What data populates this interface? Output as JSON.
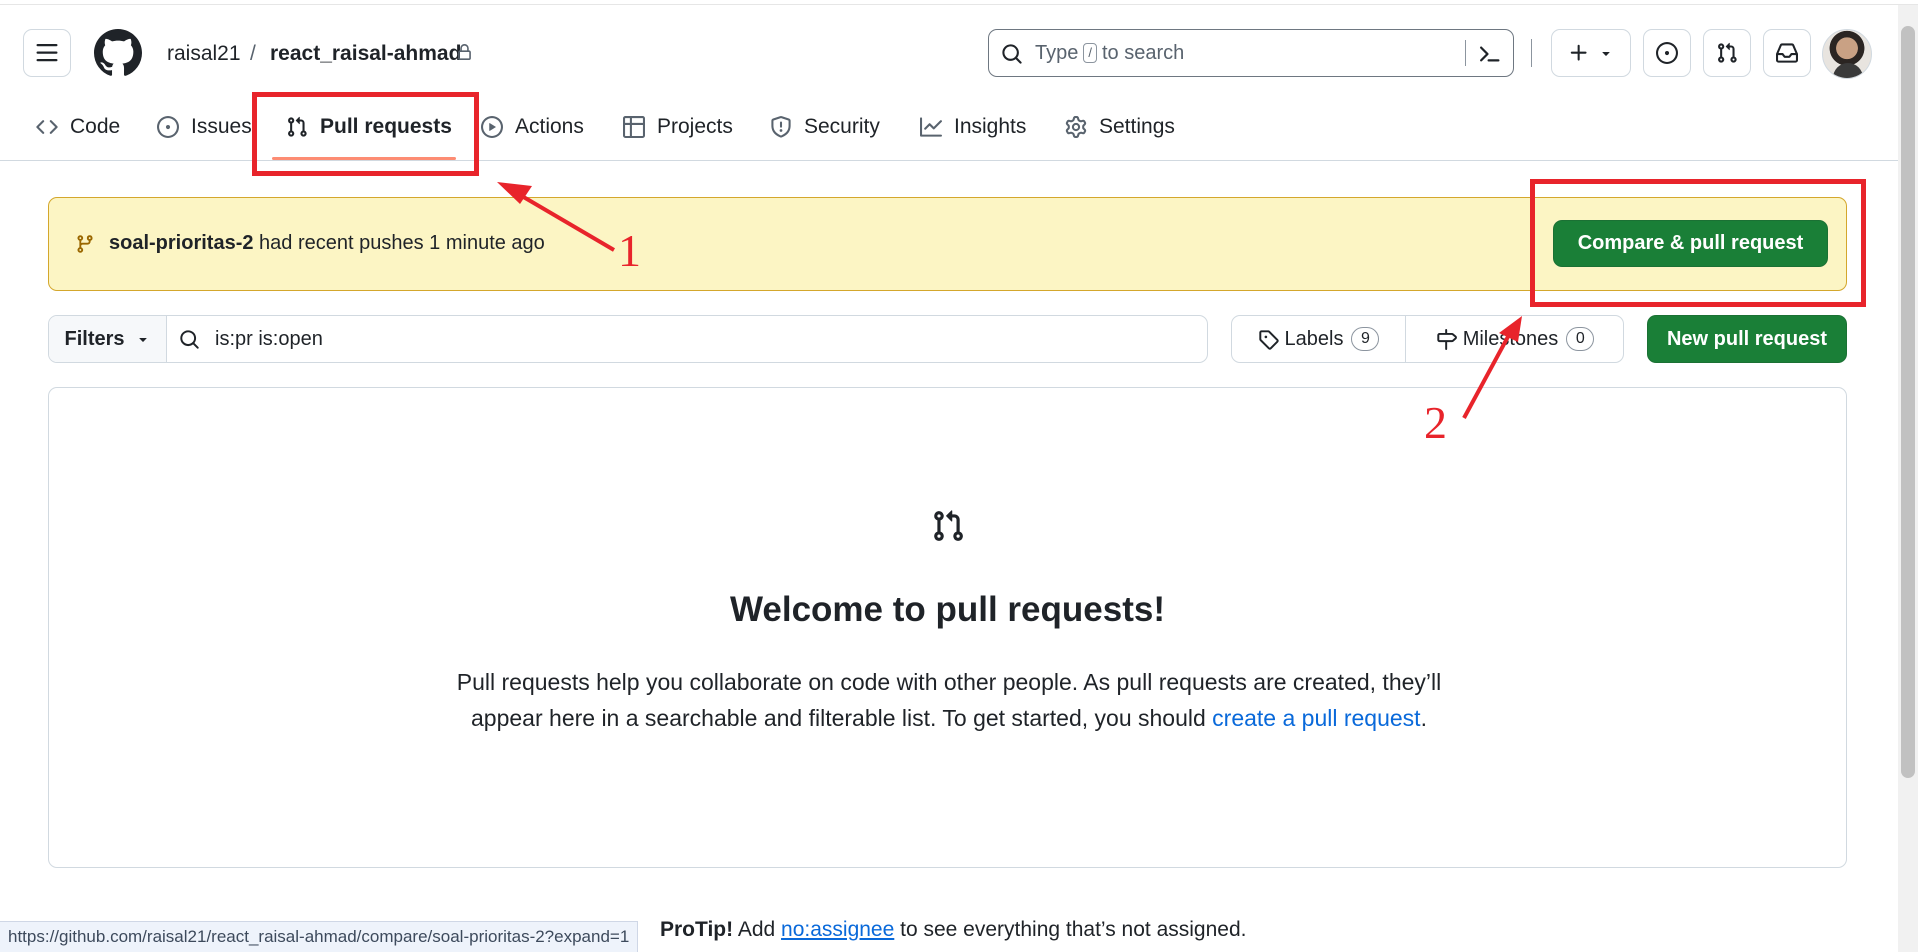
{
  "header": {
    "owner": "raisal21",
    "separator": "/",
    "repo": "react_raisal-ahmad",
    "search_prefix": "Type",
    "search_key": "/",
    "search_suffix": "to search"
  },
  "tabs": [
    {
      "label": "Code",
      "icon": "code-icon"
    },
    {
      "label": "Issues",
      "icon": "issue-opened-icon"
    },
    {
      "label": "Pull requests",
      "icon": "git-pull-request-icon",
      "selected": true
    },
    {
      "label": "Actions",
      "icon": "play-icon"
    },
    {
      "label": "Projects",
      "icon": "table-icon"
    },
    {
      "label": "Security",
      "icon": "shield-icon"
    },
    {
      "label": "Insights",
      "icon": "graph-icon"
    },
    {
      "label": "Settings",
      "icon": "gear-icon"
    }
  ],
  "banner": {
    "branch": "soal-prioritas-2",
    "message": "had recent pushes 1 minute ago",
    "compare_button": "Compare & pull request"
  },
  "filterbar": {
    "filters_label": "Filters",
    "query": "is:pr is:open",
    "labels_label": "Labels",
    "labels_count": "9",
    "milestones_label": "Milestones",
    "milestones_count": "0",
    "new_pr_button": "New pull request"
  },
  "blankslate": {
    "title": "Welcome to pull requests!",
    "text_line1": "Pull requests help you collaborate on code with other people. As pull requests are created, they’ll",
    "text_line2_prefix": "appear here in a searchable and filterable list. To get started, you should",
    "link": "create a pull request",
    "text_suffix": "."
  },
  "protip": {
    "label": "ProTip!",
    "prefix": "Add",
    "link": "no:assignee",
    "suffix": "to see everything that’s not assigned."
  },
  "status_bar": {
    "url": "https://github.com/raisal21/react_raisal-ahmad/compare/soal-prioritas-2?expand=1"
  },
  "annotations": {
    "label_1": "1",
    "label_2": "2"
  },
  "colors": {
    "primary_button": "#1a7f37",
    "banner_bg": "#fcf5c4",
    "tab_underline": "#fd8c73",
    "link": "#0969da",
    "annotation": "#e8242b"
  }
}
